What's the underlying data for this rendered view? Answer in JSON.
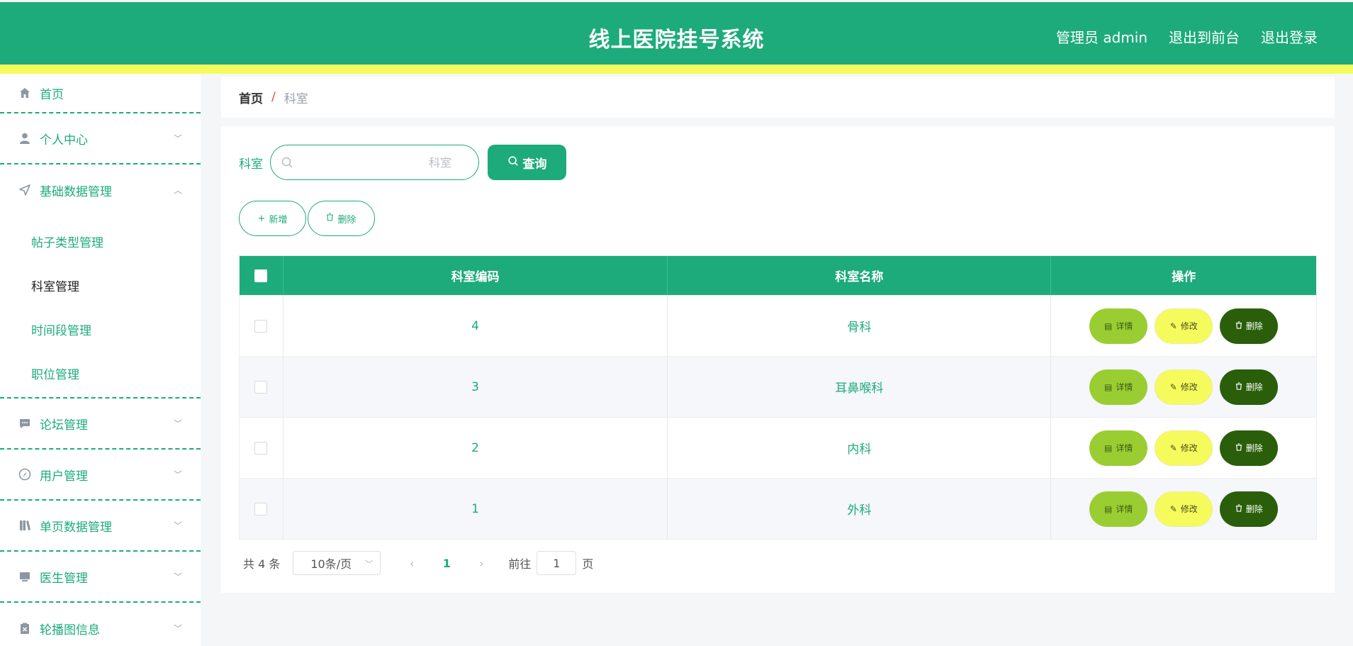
{
  "header": {
    "title": "线上医院挂号系统",
    "admin": "管理员 admin",
    "back_front": "退出到前台",
    "logout": "退出登录"
  },
  "sidebar": {
    "items": [
      {
        "label": "首页",
        "icon": "home-icon"
      },
      {
        "label": "个人中心",
        "icon": "user-icon"
      },
      {
        "label": "基础数据管理",
        "icon": "navigation-icon",
        "expanded": true,
        "children": [
          "帖子类型管理",
          "科室管理",
          "时间段管理",
          "职位管理"
        ]
      },
      {
        "label": "论坛管理",
        "icon": "chat-icon"
      },
      {
        "label": "用户管理",
        "icon": "compass-icon"
      },
      {
        "label": "单页数据管理",
        "icon": "books-icon"
      },
      {
        "label": "医生管理",
        "icon": "monitor-icon"
      },
      {
        "label": "轮播图信息",
        "icon": "clipboard-icon"
      }
    ],
    "active_child": "科室管理"
  },
  "breadcrumb": {
    "home": "首页",
    "sep": "/",
    "current": "科室"
  },
  "search": {
    "label": "科室",
    "placeholder": "科室",
    "button": "查询"
  },
  "actions": {
    "add": "新增",
    "delete": "删除"
  },
  "table": {
    "columns": [
      "科室编码",
      "科室名称",
      "操作"
    ],
    "rows": [
      {
        "code": "4",
        "name": "骨科"
      },
      {
        "code": "3",
        "name": "耳鼻喉科"
      },
      {
        "code": "2",
        "name": "内科"
      },
      {
        "code": "1",
        "name": "外科"
      }
    ],
    "row_actions": {
      "detail": "详情",
      "edit": "修改",
      "delete": "删除"
    }
  },
  "pagination": {
    "total": "共 4 条",
    "page_size": "10条/页",
    "current_page": "1",
    "goto_label": "前往",
    "goto_value": "1",
    "page_suffix": "页"
  },
  "colors": {
    "primary": "#1dab7c",
    "accent_yellow": "#f5fb5c",
    "detail_green": "#9acd32",
    "delete_dark": "#2a5e0a"
  }
}
